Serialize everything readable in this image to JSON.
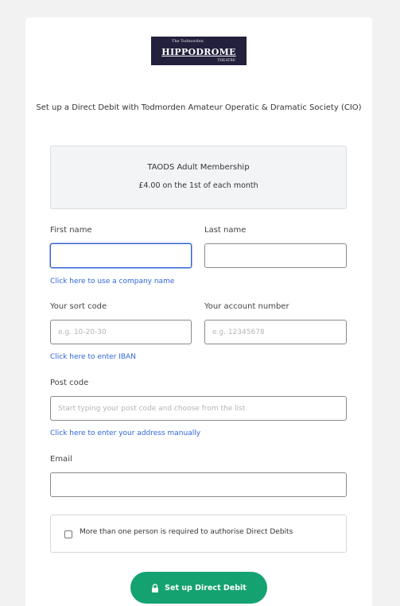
{
  "logo": {
    "top_text": "The Todmorden",
    "main_text": "HIPPODROME",
    "sub_text": "THEATRE"
  },
  "intro_text": "Set up a Direct Debit with Todmorden Amateur Operatic & Dramatic Society (CIO)",
  "summary": {
    "title": "TAODS Adult Membership",
    "detail": "£4.00 on the 1st of each month"
  },
  "form": {
    "first_name_label": "First name",
    "last_name_label": "Last name",
    "company_link": "Click here to use a company name",
    "sort_code_label": "Your sort code",
    "sort_code_placeholder": "e.g. 10-20-30",
    "account_label": "Your account number",
    "account_placeholder": "e.g. 12345678",
    "iban_link": "Click here to enter IBAN",
    "postcode_label": "Post code",
    "postcode_placeholder": "Start typing your post code and choose from the list",
    "address_link": "Click here to enter your address manually",
    "email_label": "Email",
    "multi_signatory_label": "More than one person is required to authorise Direct Debits",
    "submit_label": "Set up Direct Debit"
  },
  "colors": {
    "accent": "#15a271",
    "link": "#2f67d8",
    "focus": "#2f5fd1",
    "logo_bg": "#22203c"
  }
}
